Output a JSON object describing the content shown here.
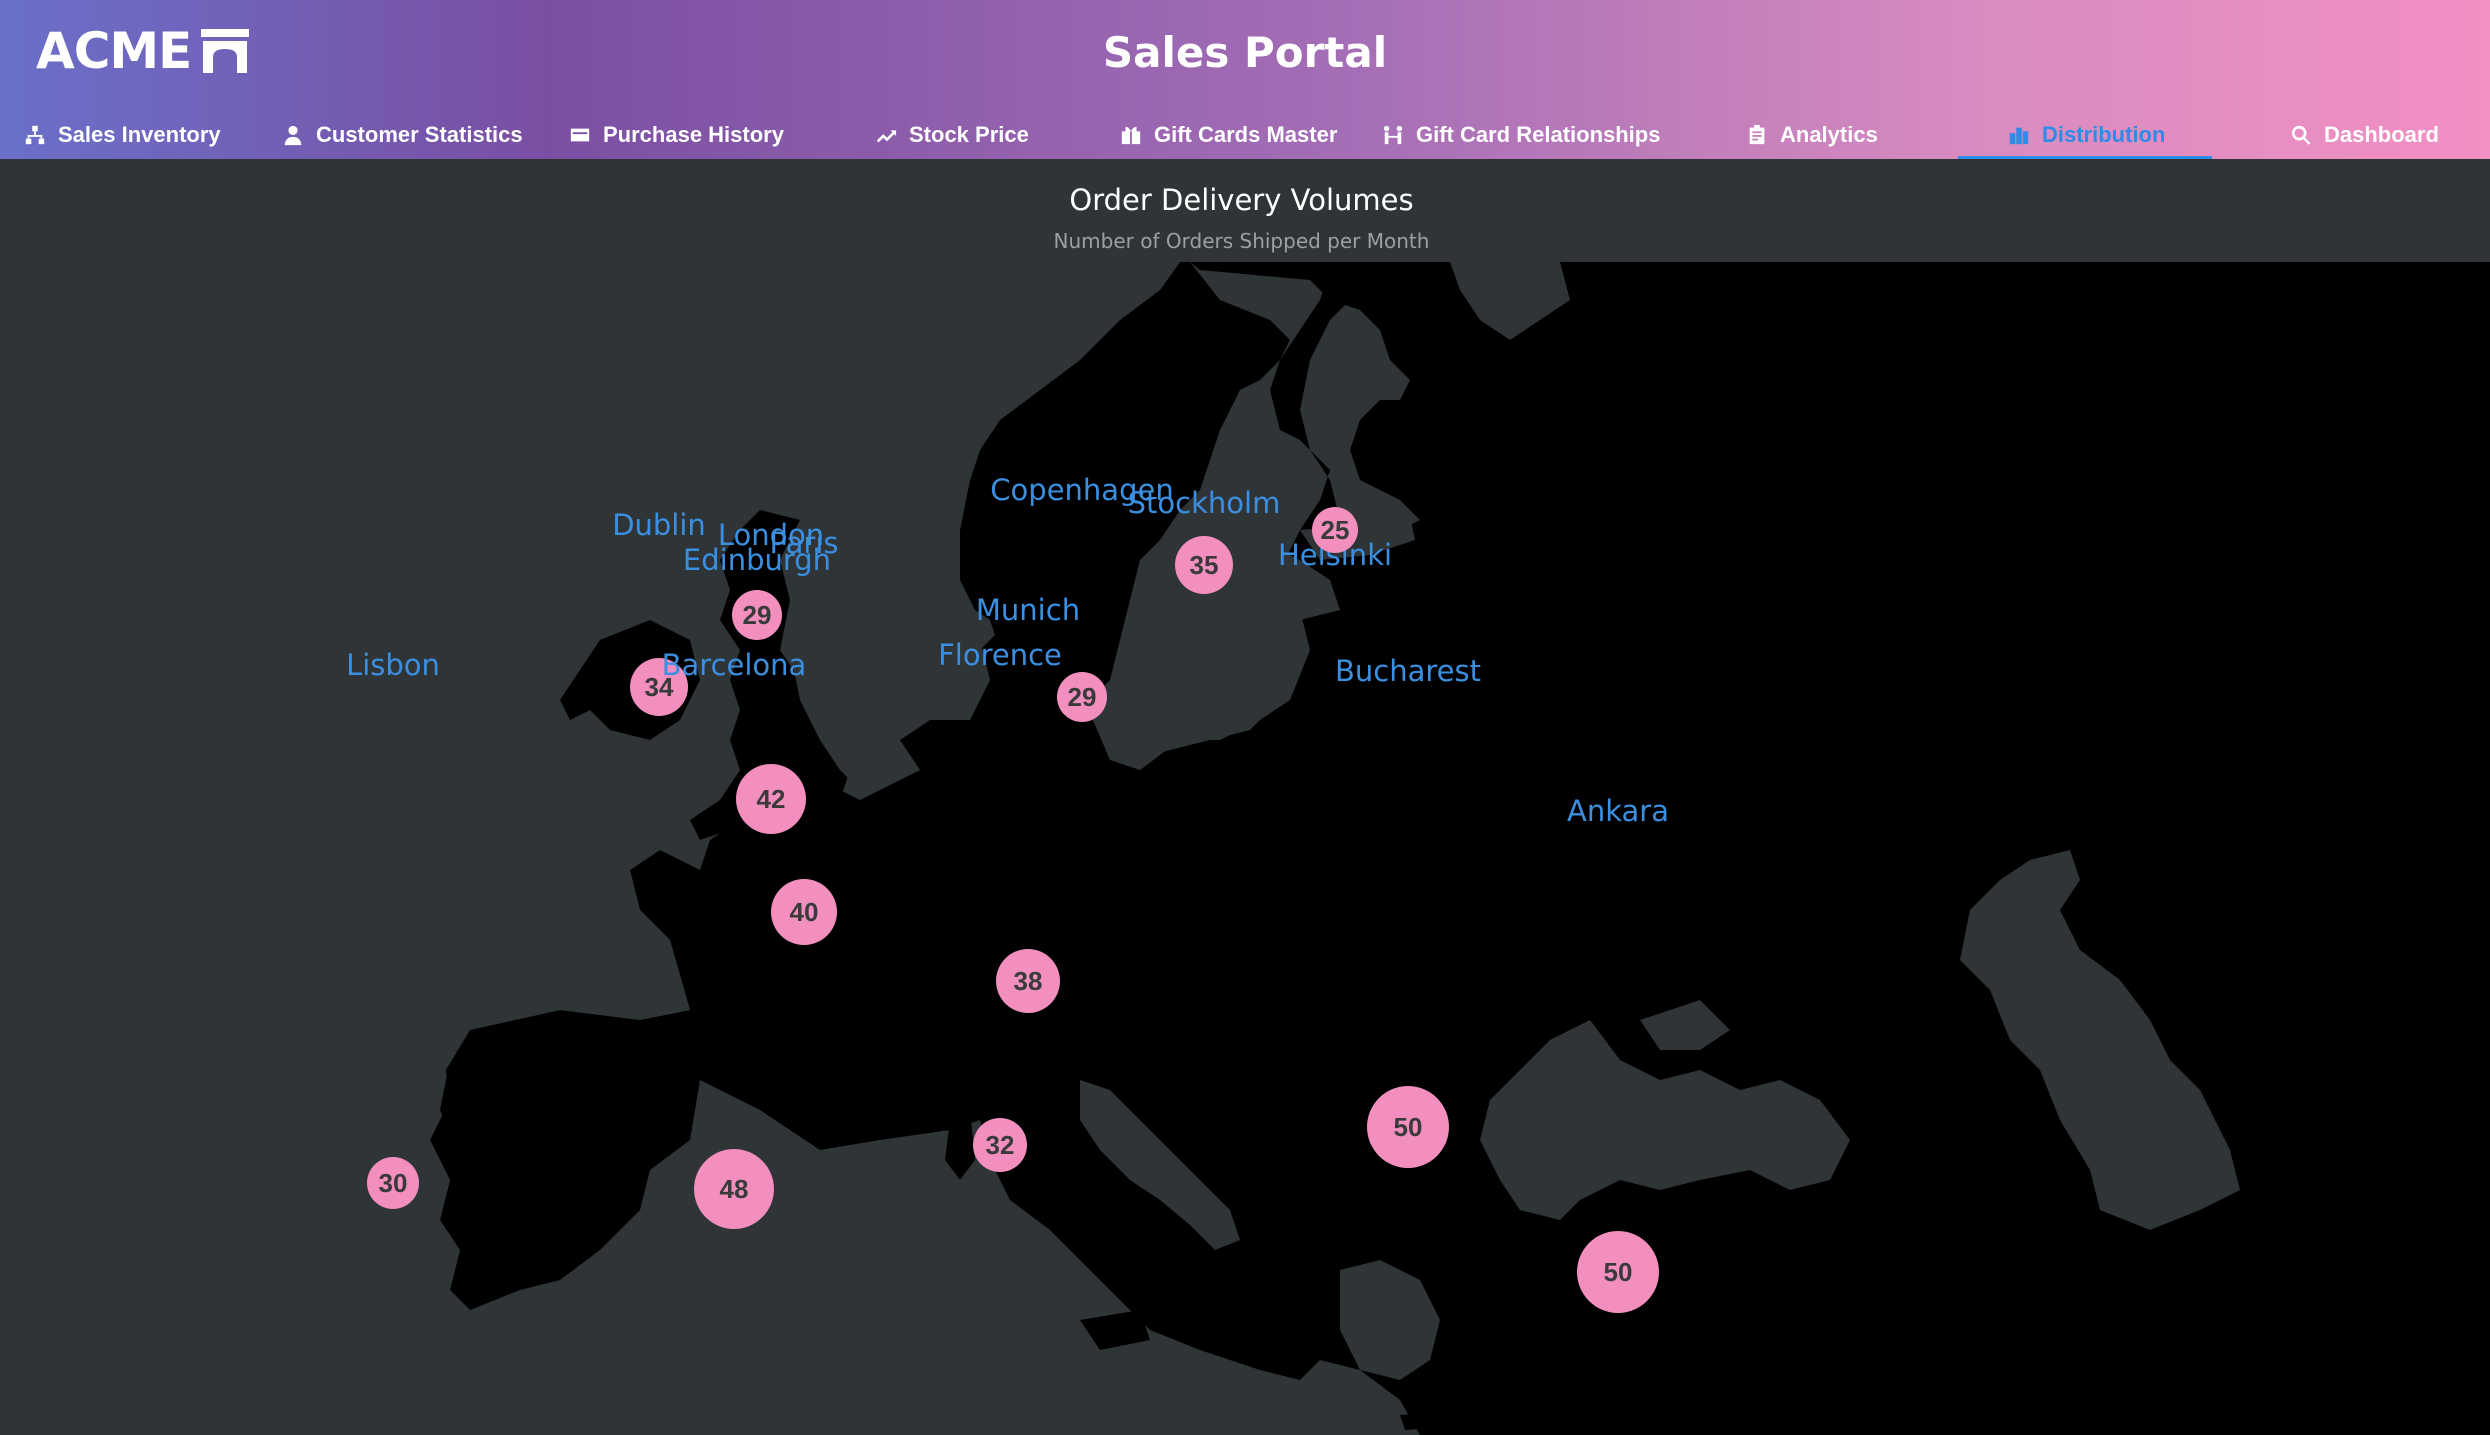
{
  "brand": {
    "logo_text": "ACME",
    "accent": "#2f8be6"
  },
  "app": {
    "title": "Sales Portal"
  },
  "nav": {
    "tabs": [
      {
        "label": "Sales Inventory",
        "icon": "sitemap-icon",
        "active": false
      },
      {
        "label": "Customer Statistics",
        "icon": "user-icon",
        "active": false
      },
      {
        "label": "Purchase History",
        "icon": "credit-card-icon",
        "active": false
      },
      {
        "label": "Stock Price",
        "icon": "trending-up-icon",
        "active": false
      },
      {
        "label": "Gift Cards Master",
        "icon": "gift-cards-icon",
        "active": false
      },
      {
        "label": "Gift Card Relationships",
        "icon": "relationships-icon",
        "active": false
      },
      {
        "label": "Analytics",
        "icon": "analytics-icon",
        "active": false
      },
      {
        "label": "Distribution",
        "icon": "distribution-icon",
        "active": true
      },
      {
        "label": "Dashboard",
        "icon": "search-dashboard-icon",
        "active": false
      }
    ]
  },
  "map": {
    "title": "Order Delivery Volumes",
    "subtitle": "Number of Orders Shipped per Month",
    "colors": {
      "land": "#000000",
      "sea": "#2f3437",
      "bubble": "#f28fbf",
      "label": "#3b8fe0"
    },
    "cities": [
      {
        "name": "Helsinki",
        "value": 25
      },
      {
        "name": "Stockholm",
        "value": 35
      },
      {
        "name": "Edinburgh",
        "value": 29
      },
      {
        "name": "Dublin",
        "value": 34
      },
      {
        "name": "Copenhagen",
        "value": 29
      },
      {
        "name": "London",
        "value": 42
      },
      {
        "name": "Paris",
        "value": 40
      },
      {
        "name": "Munich",
        "value": 38
      },
      {
        "name": "Bucharest",
        "value": 50
      },
      {
        "name": "Florence",
        "value": 32
      },
      {
        "name": "Barcelona",
        "value": 48
      },
      {
        "name": "Lisbon",
        "value": 30
      },
      {
        "name": "Ankara",
        "value": 50
      }
    ]
  }
}
